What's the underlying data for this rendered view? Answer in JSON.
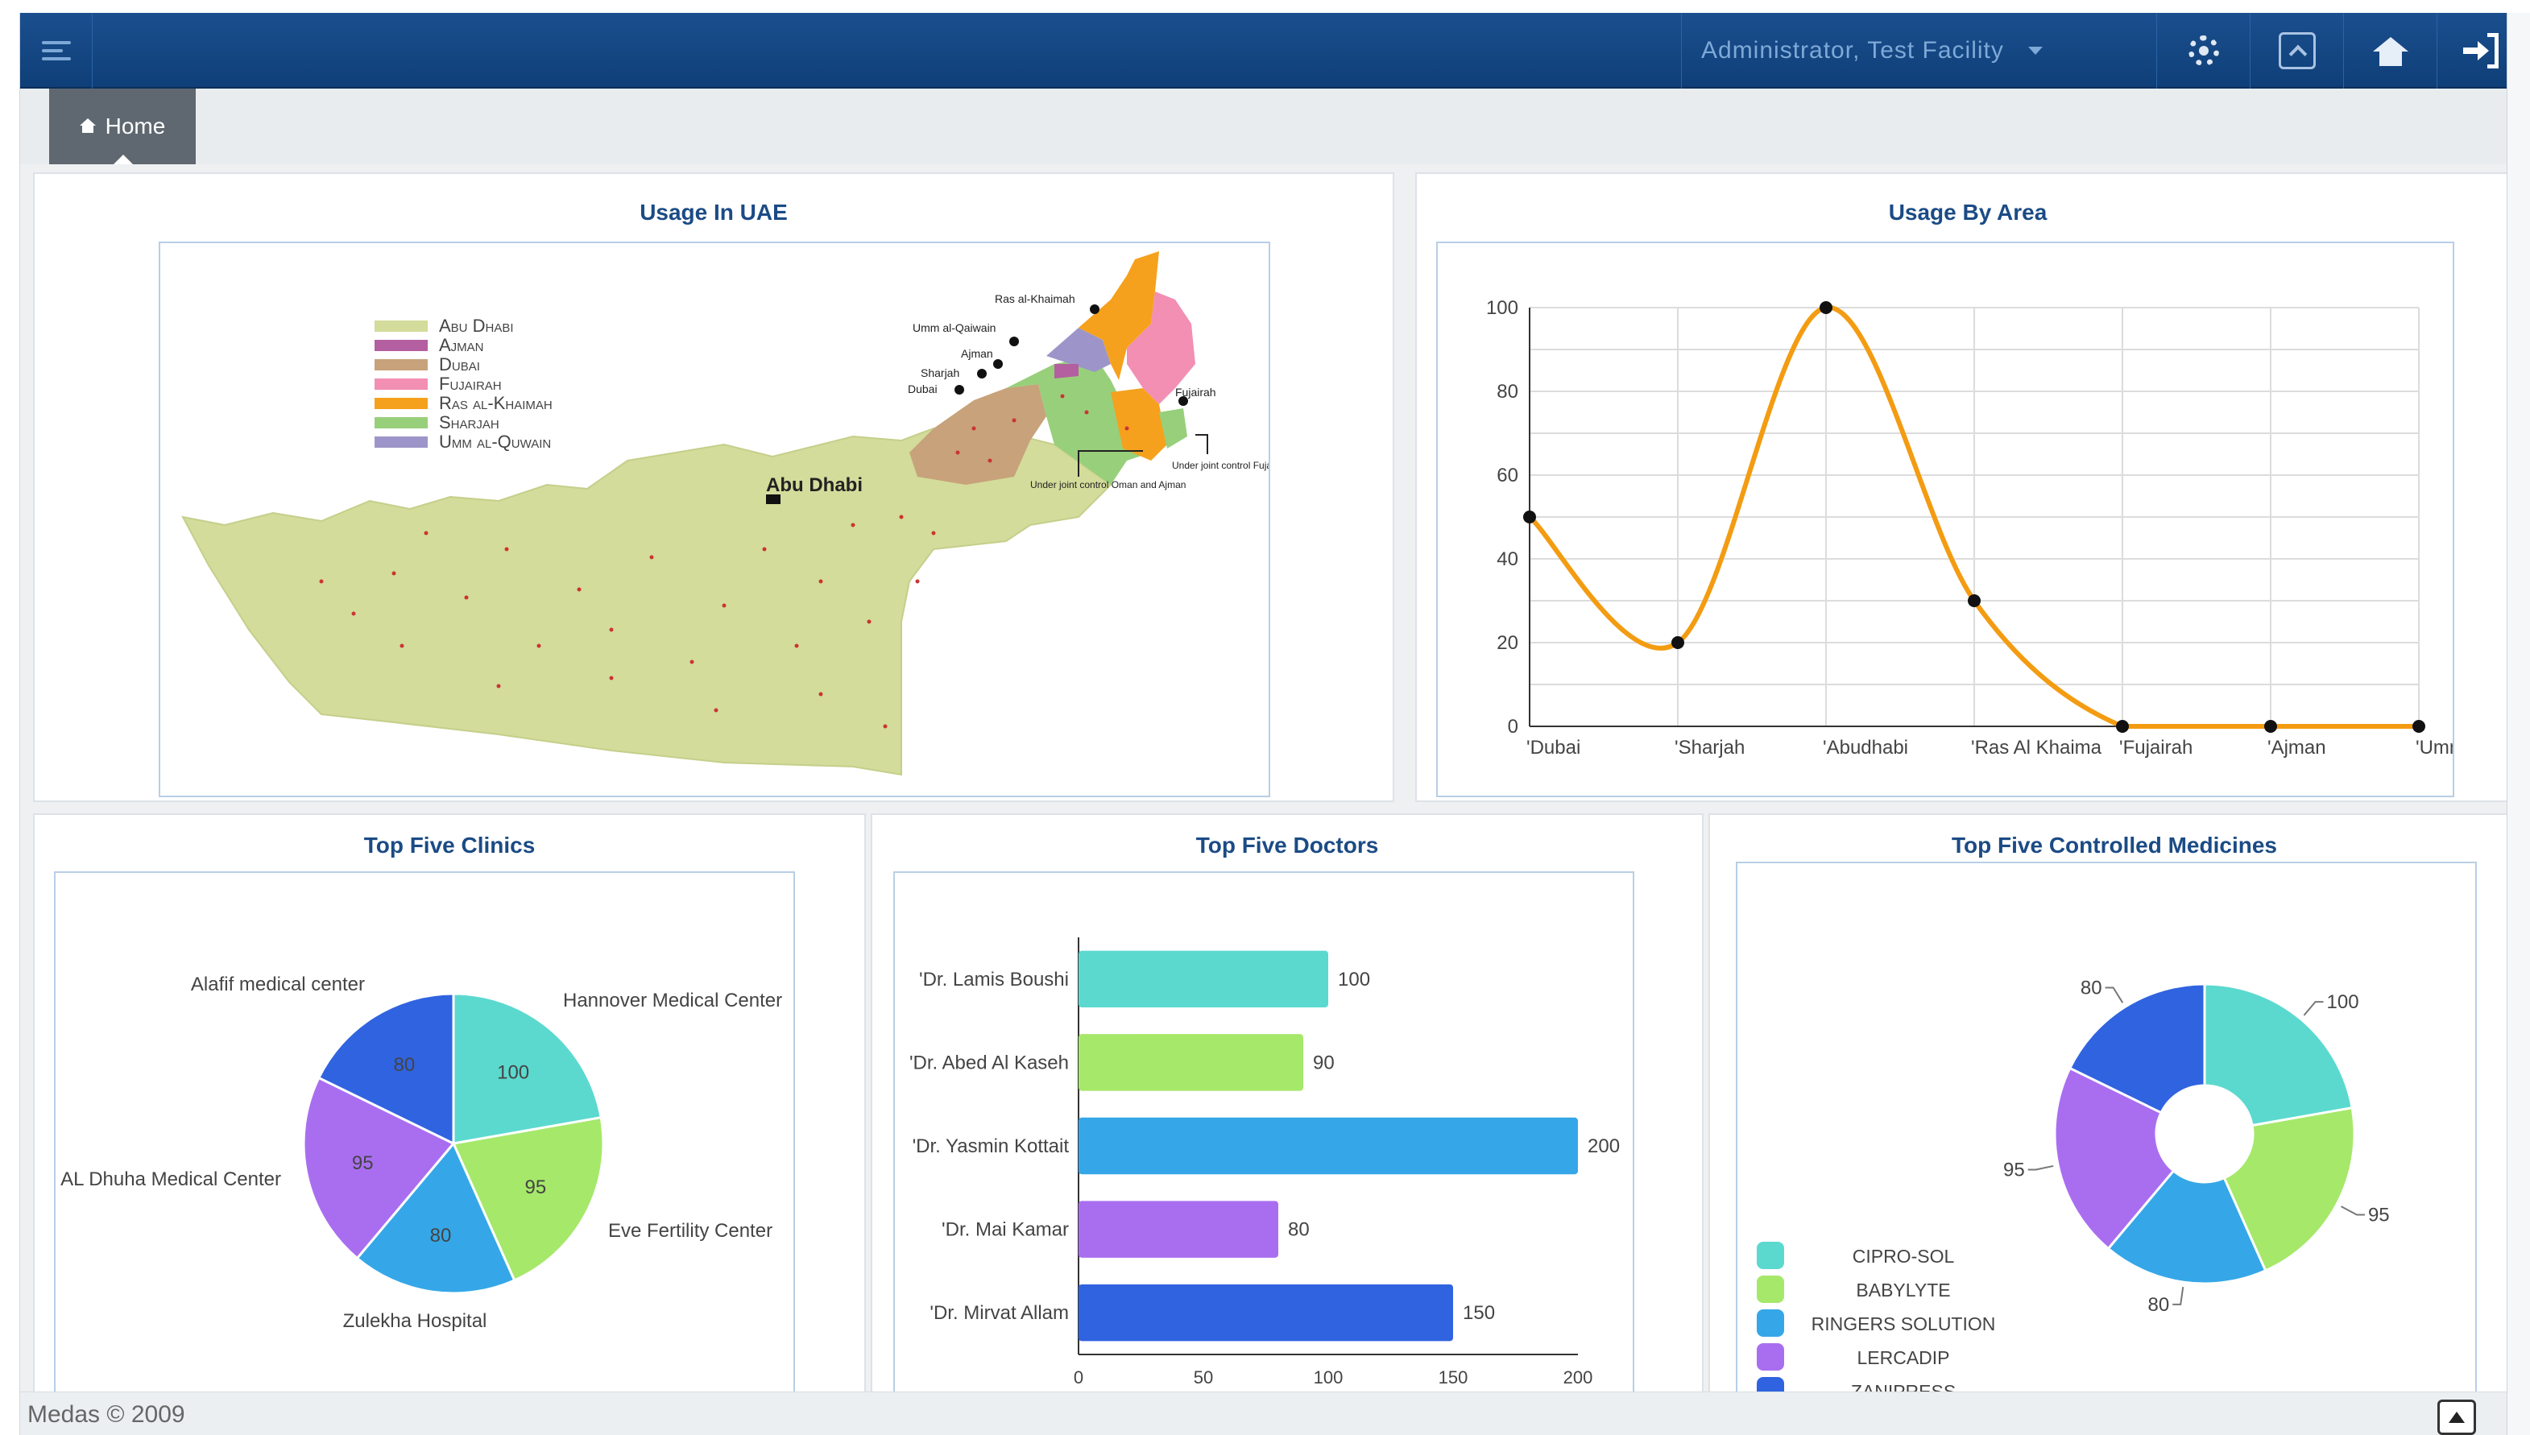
{
  "header": {
    "user_label": "Administrator, Test Facility",
    "icons": [
      "menu-icon",
      "gear-icon",
      "collapse-icon",
      "home-icon",
      "sign-out-icon"
    ]
  },
  "breadcrumb": {
    "home_label": "Home"
  },
  "colors": {
    "topbar": "#0f3f78",
    "title": "#1b4b85",
    "line": "#f39c12",
    "teal": "#5bd9cf",
    "green": "#a6e86a",
    "blue": "#35a7e8",
    "purple": "#a96ef0",
    "royal": "#3063e0"
  },
  "panels": {
    "uae": {
      "title": "Usage In UAE",
      "legend": [
        "Abu Dhabi",
        "Ajman",
        "Dubai",
        "Fujairah",
        "Ras al-Khaimah",
        "Sharjah",
        "Umm al-Quwain"
      ],
      "map_labels": {
        "abu_dhabi": "Abu Dhabi",
        "ras_al_khaimah": "Ras al-Khaimah",
        "umm_al_qaiwain": "Umm al-Qaiwain",
        "ajman": "Ajman",
        "sharjah": "Sharjah",
        "dubai": "Dubai",
        "fujairah": "Fujairah",
        "joint_oman": "Under joint control Oman and Ajman",
        "joint_fujairah": "Under joint control Fujairah and Sharjah"
      }
    },
    "area": {
      "title": "Usage By Area"
    },
    "clinics": {
      "title": "Top Five Clinics"
    },
    "doctors": {
      "title": "Top Five Doctors"
    },
    "medicines": {
      "title": "Top Five Controlled Medicines"
    }
  },
  "chart_data": [
    {
      "type": "line",
      "categories": [
        "'Dubai",
        "'Sharjah",
        "'Abudhabi",
        "'Ras Al Khaima",
        "'Fujairah",
        "'Ajman",
        "'Umm Al Quv"
      ],
      "values": [
        50,
        20,
        100,
        30,
        0,
        0,
        0
      ],
      "ylim": [
        0,
        100
      ],
      "yticks": [
        0,
        20,
        40,
        60,
        80,
        100
      ],
      "grid": true
    },
    {
      "type": "pie",
      "labels": [
        "Hannover Medical Center",
        "Eve Fertility Center",
        "Zulekha Hospital",
        "AL Dhuha Medical Center",
        "Alafif medical center"
      ],
      "values": [
        100,
        95,
        80,
        95,
        80
      ]
    },
    {
      "type": "bar",
      "orientation": "horizontal",
      "categories": [
        "'Dr. Lamis Boushi",
        "'Dr. Abed Al Kaseh",
        "'Dr. Yasmin Kottait",
        "'Dr. Mai Kamar",
        "'Dr. Mirvat Allam"
      ],
      "values": [
        100,
        90,
        200,
        80,
        150
      ],
      "xlim": [
        0,
        200
      ],
      "xticks": [
        0,
        50,
        100,
        150,
        200
      ]
    },
    {
      "type": "pie",
      "donut": true,
      "legend": [
        "CIPRO-SOL",
        "BABYLYTE",
        "RINGERS SOLUTION",
        "LERCADIP",
        "ZANIPRESS"
      ],
      "values": [
        100,
        95,
        80,
        95,
        80
      ],
      "legend_position": "bottom-left"
    }
  ],
  "footer": {
    "copyright": "Medas © 2009"
  }
}
